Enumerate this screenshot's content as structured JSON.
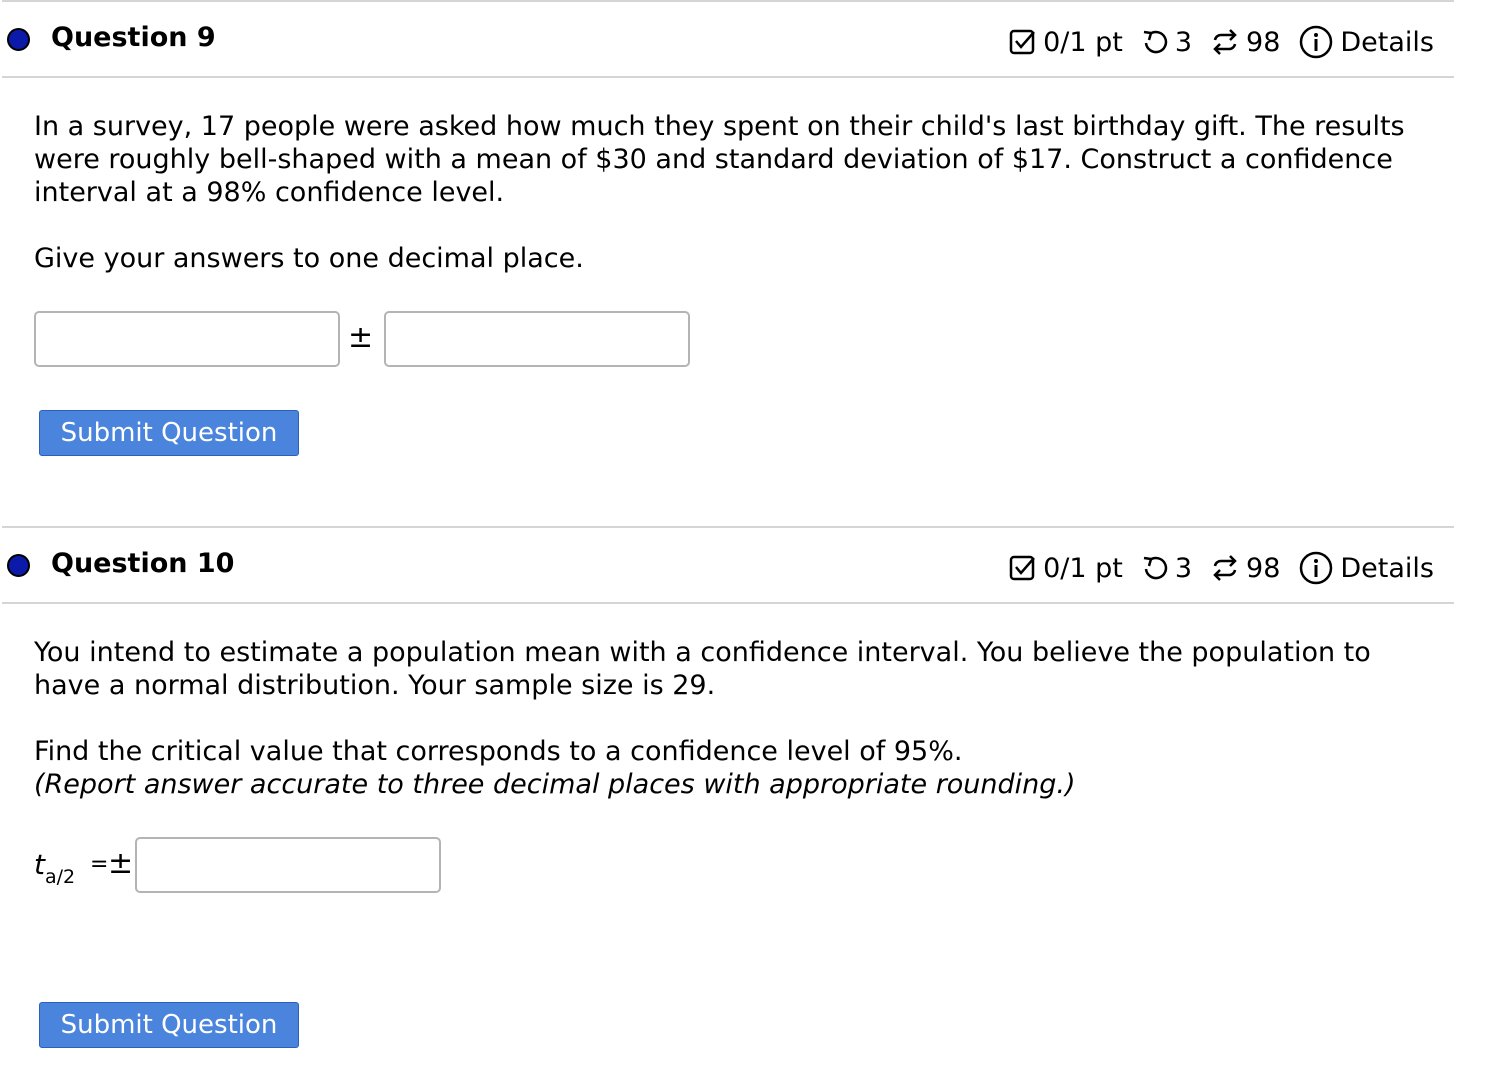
{
  "q9": {
    "title": "Question 9",
    "score": "0/1 pt",
    "retries": "3",
    "attempts": "98",
    "details": "Details",
    "para1": "In a survey, 17 people were asked how much they spent on their child's last birthday gift. The results were roughly bell-shaped with a mean of $30 and standard deviation of $17. Construct a confidence interval at a 98% confidence level.",
    "para2": "Give your answers to one decimal place.",
    "input1_value": "",
    "plusminus": "±",
    "input2_value": "",
    "submit_label": "Submit Question"
  },
  "q10": {
    "title": "Question 10",
    "score": "0/1 pt",
    "retries": "3",
    "attempts": "98",
    "details": "Details",
    "para1": "You intend to estimate a population mean with a confidence interval. You believe the population to have a normal distribution. Your sample size is 29.",
    "para2": "Find the critical value that corresponds to a confidence level of 95%.",
    "para3": "(Report answer accurate to three decimal places with appropriate rounding.)",
    "label_t": "t",
    "label_sub": "a/2",
    "label_eq": "=",
    "plusminus": "±",
    "input_value": "",
    "submit_label": "Submit Question"
  },
  "colors": {
    "status_dot": "#0b1aa8",
    "button": "#4a84dd",
    "divider": "#d5d5d5"
  },
  "icons": [
    "checkbox-icon",
    "retry-icon",
    "attempts-icon",
    "info-icon"
  ]
}
